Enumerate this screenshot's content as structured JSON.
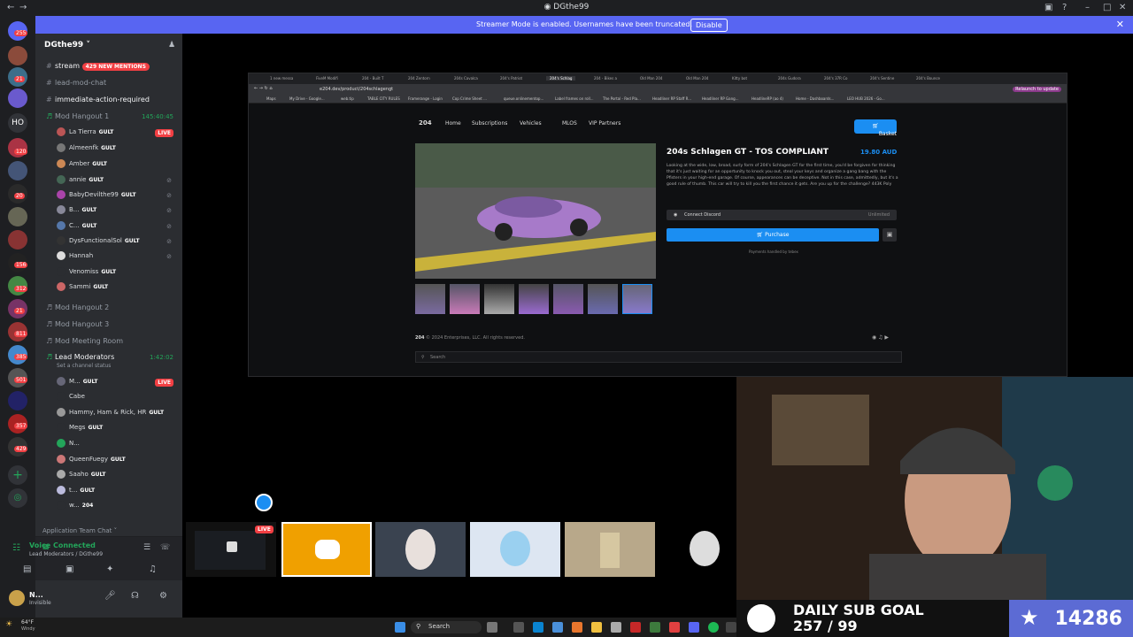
{
  "window": {
    "title": "DGthe99"
  },
  "banner": {
    "message": "Streamer Mode is enabled. Usernames have been truncated.",
    "disable_label": "Disable"
  },
  "guild_badges": [
    "255",
    "21",
    "120",
    "20",
    "156",
    "312",
    "21",
    "811",
    "385",
    "501",
    "357",
    "429"
  ],
  "server": {
    "name": "DGthe99"
  },
  "channels": {
    "stream": "stream",
    "stream_mentions": "429 NEW MENTIONS",
    "lead_mod_chat": "lead-mod-chat",
    "immediate": "immediate-action-required",
    "mod_hangout_1": "Mod Hangout 1",
    "mod_hangout_1_time": "145:40:45",
    "mod_hangout_2": "Mod Hangout 2",
    "mod_hangout_3": "Mod Hangout 3",
    "mod_meeting": "Mod Meeting Room",
    "lead_moderators": "Lead Moderators",
    "lead_moderators_time": "1:42:02",
    "lead_moderators_status": "Set a channel status",
    "app_team_chat": "Application Team Chat"
  },
  "hangout1_users": [
    {
      "name": "La Tierra",
      "tag": "GULT",
      "live": "LIVE"
    },
    {
      "name": "Almeenfk",
      "tag": "GULT"
    },
    {
      "name": "Amber",
      "tag": "GULT"
    },
    {
      "name": "annie",
      "tag": "GULT"
    },
    {
      "name": "BabyDevilthe99",
      "tag": "GULT"
    },
    {
      "name": "B...",
      "tag": "GULT"
    },
    {
      "name": "C...",
      "tag": "GULT"
    },
    {
      "name": "DysFunctionalSol",
      "tag": "GULT"
    },
    {
      "name": "Hannah",
      "tag": ""
    },
    {
      "name": "Venomiss",
      "tag": "GULT"
    },
    {
      "name": "Sammi",
      "tag": "GULT"
    }
  ],
  "lead_users": [
    {
      "name": "M...",
      "tag": "GULT",
      "live": "LIVE"
    },
    {
      "name": "Cabe",
      "tag": ""
    },
    {
      "name": "Hammy, Ham & Rick, HR",
      "tag": "GULT"
    },
    {
      "name": "Megs",
      "tag": "GULT"
    },
    {
      "name": "N...",
      "tag": ""
    },
    {
      "name": "QueenFuegy",
      "tag": "GULT"
    },
    {
      "name": "Saaho",
      "tag": "GULT"
    },
    {
      "name": "t...",
      "tag": "GULT"
    },
    {
      "name": "w...",
      "tag": "204"
    }
  ],
  "voice": {
    "status": "Voice Connected",
    "location": "Lead Moderators / DGthe99"
  },
  "me": {
    "name": "N...",
    "status": "Invisible"
  },
  "browser": {
    "tabs": [
      "1 new messa",
      "FiveM Modifi",
      "204 - Built T",
      "204 Zentorn",
      "204s Cavalca",
      "204's Patriot",
      "204's Schlag",
      "204 - Bikes a",
      "Old Man 204",
      "Old Man 204",
      "Kitty bot",
      "204s Gudora",
      "204's 37R Co",
      "204's Sentine",
      "204's Bounce"
    ],
    "url": "e204.dev/product/204schlagengt",
    "relaunch": "Relaunch to update",
    "bookmarks": [
      "Maps",
      "My Drive - Google...",
      "web.tip",
      "TABLE CITY RULES",
      "Framerange - Login",
      "Cop Crime Sheet ...",
      "queue.onlinementop...",
      "Label frames on roll...",
      "The Portal - Red Pla...",
      "Headliner RP Staff R...",
      "Headliner RP Gang...",
      "HeadlineRP (ao 4)",
      "Home - Dashboards...",
      "LEO HUB 2026 - Go..."
    ]
  },
  "site": {
    "nav": [
      "Home",
      "Subscriptions",
      "Vehicles",
      "MLOS",
      "VIP Partners"
    ],
    "basket": "Basket",
    "product_title": "204s Schlagen GT - TOS COMPLIANT",
    "price": "19.80 AUD",
    "description": "Looking at the wide, low, broad, surly form of 204's Schlagen GT for the first time, you'd be forgiven for thinking that it's just waiting for an opportunity to knock you out, steal your keys and organize a gang bang with the Pfisters in your high-end garage. Of course, appearances can be deceptive. Not in this case, admittedly, but it's a good rule of thumb. This car will try to kill you the first chance it gets. Are you up for the challenge? 443K Poly",
    "connect_discord": "Connect Discord",
    "unlimited": "Unlimited",
    "purchase": "Purchase",
    "payments": "Payments handled by",
    "payments_brand": "tebex",
    "copyright": "© 2024 Enterprises, LLC. All rights reserved.",
    "search_placeholder": "Search"
  },
  "stream_strip": {
    "live": "LIVE"
  },
  "taskbar": {
    "search": "Search",
    "weather_temp": "64°F",
    "weather_desc": "Windy"
  },
  "overlay": {
    "goal_title": "DAILY SUB GOAL",
    "goal_progress": "257 / 99",
    "sub_count": "14286"
  }
}
